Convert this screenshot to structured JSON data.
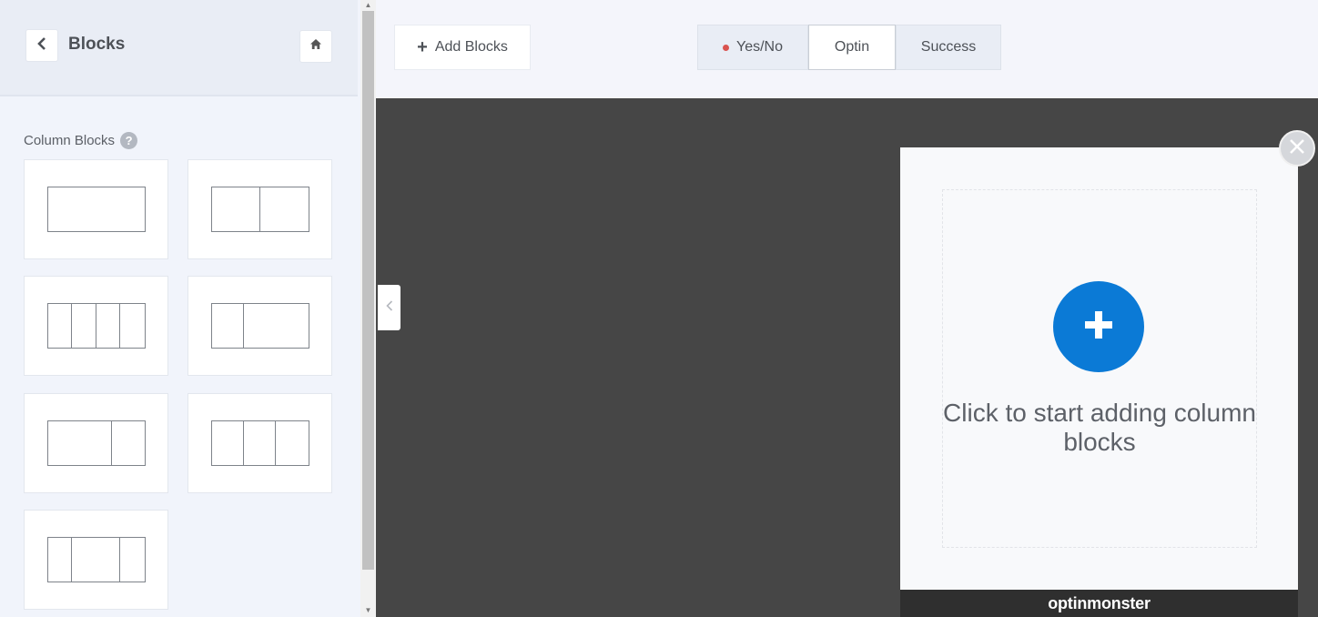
{
  "sidebar": {
    "title": "Blocks",
    "section_label": "Column Blocks",
    "help_glyph": "?",
    "tiles": [
      {
        "name": "column-block-1",
        "cols": [
          1
        ]
      },
      {
        "name": "column-block-1-1",
        "cols": [
          1,
          1
        ]
      },
      {
        "name": "column-block-1-1-1-1",
        "cols": [
          1,
          1,
          1,
          1
        ]
      },
      {
        "name": "column-block-1-3",
        "cols": [
          1,
          2
        ]
      },
      {
        "name": "column-block-3-1",
        "cols": [
          2,
          1
        ]
      },
      {
        "name": "column-block-1-1-1",
        "cols": [
          1,
          1,
          1
        ]
      },
      {
        "name": "column-block-1-2-1",
        "cols": [
          1,
          2,
          1
        ]
      }
    ]
  },
  "toolbar": {
    "add_blocks_label": "Add Blocks",
    "tabs": [
      {
        "label": "Yes/No",
        "has_dot": true,
        "active": false
      },
      {
        "label": "Optin",
        "has_dot": false,
        "active": true
      },
      {
        "label": "Success",
        "has_dot": false,
        "active": false
      }
    ]
  },
  "canvas": {
    "popup_text": "Click to start adding column blocks",
    "brand": "optinmonster"
  },
  "colors": {
    "accent_blue": "#0b7ad6",
    "canvas_bg": "#464646",
    "dot_red": "#d9534f"
  }
}
